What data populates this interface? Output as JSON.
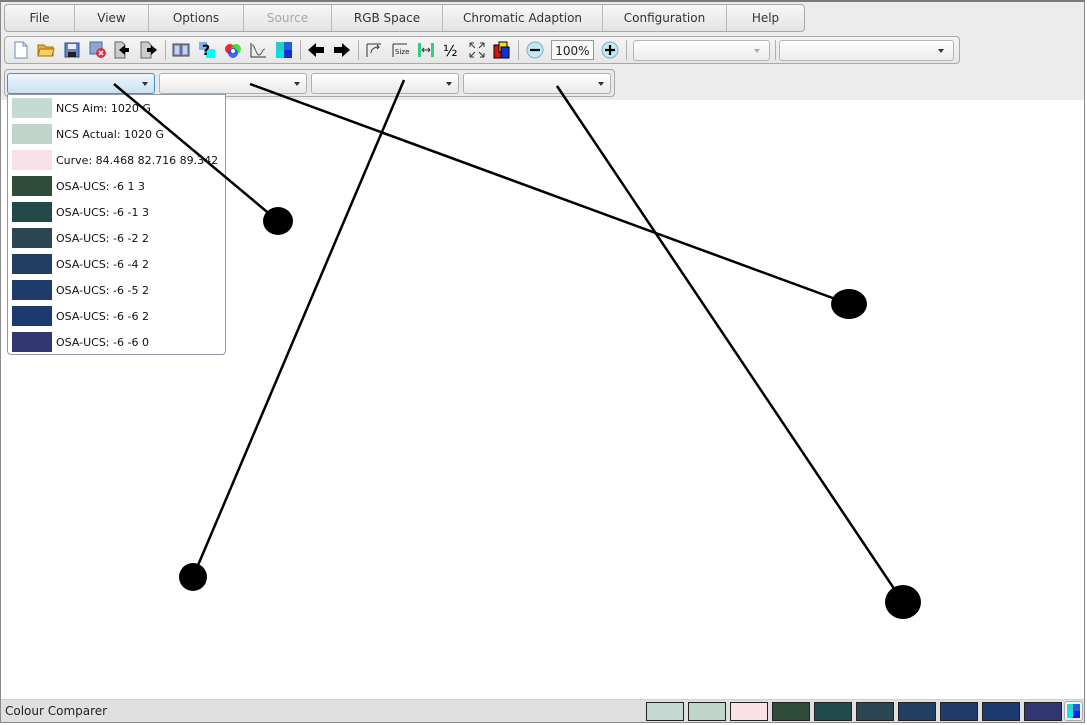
{
  "app": {
    "title": "Colour Comparer"
  },
  "menu": [
    {
      "label": "File",
      "enabled": true
    },
    {
      "label": "View",
      "enabled": true
    },
    {
      "label": "Options",
      "enabled": true
    },
    {
      "label": "Source",
      "enabled": false
    },
    {
      "label": "RGB Space",
      "enabled": true
    },
    {
      "label": "Chromatic Adaption",
      "enabled": true
    },
    {
      "label": "Configuration",
      "enabled": true
    },
    {
      "label": "Help",
      "enabled": true
    }
  ],
  "toolbar": {
    "icons": [
      "new-document-icon",
      "open-folder-icon",
      "save-icon",
      "delete-file-icon",
      "import-icon",
      "export-icon",
      "book-icon",
      "help-swatch-icon",
      "color-wheel-icon",
      "curve-chart-icon",
      "swatch-grid-icon",
      "back-arrow-icon",
      "forward-arrow-icon",
      "swap-axes-icon",
      "size-icon",
      "fit-width-icon",
      "half-icon",
      "fullscreen-icon",
      "overlap-swatches-icon",
      "zoom-out-icon",
      "zoom-in-icon"
    ],
    "zoom_value": "100%",
    "combo1_value": "",
    "combo2_value": ""
  },
  "selectors": [
    {
      "value": ""
    },
    {
      "value": ""
    },
    {
      "value": ""
    },
    {
      "value": ""
    }
  ],
  "dropdown": {
    "items": [
      {
        "label": "NCS Aim: 1020 G",
        "color": "#c5dad2"
      },
      {
        "label": "NCS Actual: 1020 G",
        "color": "#bfd5ca"
      },
      {
        "label": "Curve: 84.468 82.716 89.342",
        "color": "#f9e1e8"
      },
      {
        "label": "OSA-UCS: -6 1 3",
        "color": "#2f4b3a"
      },
      {
        "label": "OSA-UCS: -6 -1 3",
        "color": "#234a4b"
      },
      {
        "label": "OSA-UCS: -6 -2 2",
        "color": "#2b4553"
      },
      {
        "label": "OSA-UCS: -6 -4 2",
        "color": "#223f63"
      },
      {
        "label": "OSA-UCS: -6 -5 2",
        "color": "#213b6a"
      },
      {
        "label": "OSA-UCS: -6 -6 2",
        "color": "#1d3a70"
      },
      {
        "label": "OSA-UCS: -6 -6 0",
        "color": "#313570"
      }
    ]
  },
  "status_swatches": [
    "#c5dad2",
    "#bfd5ca",
    "#f9e1e8",
    "#2f4b3a",
    "#234a4b",
    "#2b4553",
    "#223f63",
    "#213b6a",
    "#1d3a70",
    "#313570"
  ]
}
